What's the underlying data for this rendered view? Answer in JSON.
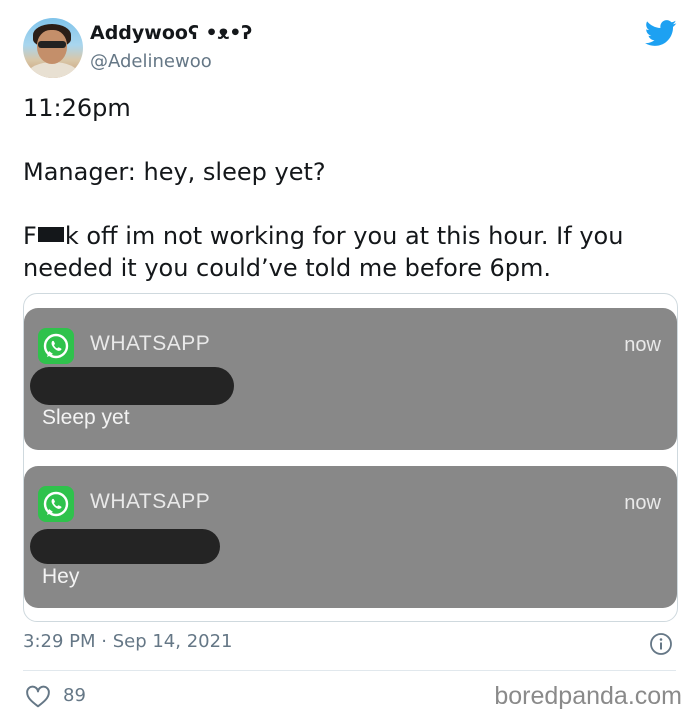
{
  "user": {
    "display_name": "Addywooʕ •ᴥ•ʔ",
    "handle": "@Adelinewoo"
  },
  "tweet": {
    "line1": "11:26pm",
    "line2": "Manager: hey, sleep yet?",
    "line3_prefix": "F",
    "line3_rest": "k off im not working for you at this hour. If you needed it you could’ve told me before 6pm."
  },
  "notifications": [
    {
      "app": "WHATSAPP",
      "time": "now",
      "message": "Sleep yet",
      "icon": "whatsapp-icon"
    },
    {
      "app": "WHATSAPP",
      "time": "now",
      "message": "Hey",
      "icon": "whatsapp-icon"
    }
  ],
  "footer": {
    "timestamp": "3:29 PM · Sep 14, 2021",
    "likes": "89",
    "watermark": "boredpanda.com"
  },
  "colors": {
    "twitter_blue": "#1da1f2",
    "whatsapp_green": "#2fc24c",
    "notification_gray": "#888888"
  }
}
